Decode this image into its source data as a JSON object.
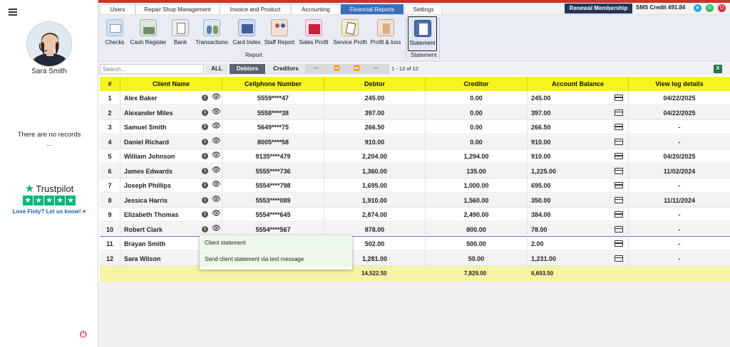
{
  "sidebar": {
    "user_name": "Sara Smith",
    "empty_text_line1": "There are no records",
    "empty_text_line2": "...",
    "trustpilot_label": "Trustpilot",
    "trustpilot_cta": "Love Finty? Let us know!"
  },
  "nav": {
    "tabs": [
      {
        "label": "Users"
      },
      {
        "label": "Repair Shop Management"
      },
      {
        "label": "Invoice and Product"
      },
      {
        "label": "Accounting"
      },
      {
        "label": "Financial Reports",
        "active": true
      },
      {
        "label": "Settings"
      }
    ],
    "renewal_button": "Renewal Membership",
    "sms_credit": "SMS Credit 491.84"
  },
  "ribbon": {
    "buttons": [
      {
        "label": "Checks",
        "icon": "checks-icon"
      },
      {
        "label": "Cash Register",
        "icon": "cash-register-icon"
      },
      {
        "label": "Bank",
        "icon": "bank-icon"
      },
      {
        "label": "Transactions",
        "icon": "transactions-icon"
      },
      {
        "label": "Card Index",
        "icon": "card-index-icon"
      },
      {
        "label": "Staff Report",
        "icon": "staff-report-icon"
      },
      {
        "label": "Sales Profit",
        "icon": "sales-profit-icon"
      },
      {
        "label": "Service Profit",
        "icon": "service-profit-icon"
      },
      {
        "label": "Profit & loss",
        "icon": "profit-loss-icon"
      },
      {
        "label": "Statement",
        "icon": "statement-icon",
        "selected": true
      }
    ],
    "group_report": "Report",
    "group_statement": "Statement"
  },
  "toolbar": {
    "search_placeholder": "Search...",
    "filter_all": "ALL",
    "filter_debtors": "Debtors",
    "filter_creditors": "Creditors",
    "page_info": "1 - 12 of 12",
    "export_icon": "excel-icon"
  },
  "table": {
    "headers": [
      "#",
      "Client Name",
      "Cellphone Number",
      "Debtor",
      "Creditor",
      "Account Balance",
      "View log details"
    ],
    "rows": [
      {
        "num": "1",
        "name": "Alex Baker",
        "phone": "5559****47",
        "debtor": "245.00",
        "creditor": "0.00",
        "balance": "245.00",
        "log": "04/22/2025"
      },
      {
        "num": "2",
        "name": "Alexander Miles",
        "phone": "5558****38",
        "debtor": "397.00",
        "creditor": "0.00",
        "balance": "397.00",
        "log": "04/22/2025"
      },
      {
        "num": "3",
        "name": "Samuel Smith",
        "phone": "5649****75",
        "debtor": "266.50",
        "creditor": "0.00",
        "balance": "266.50",
        "log": "-"
      },
      {
        "num": "4",
        "name": "Daniel Richard",
        "phone": "8005****58",
        "debtor": "910.00",
        "creditor": "0.00",
        "balance": "910.00",
        "log": "-"
      },
      {
        "num": "5",
        "name": "William Johnson",
        "phone": "9135****479",
        "debtor": "2,204.00",
        "creditor": "1,294.00",
        "balance": "910.00",
        "log": "04/20/2025"
      },
      {
        "num": "6",
        "name": "James Edwards",
        "phone": "5555****736",
        "debtor": "1,360.00",
        "creditor": "135.00",
        "balance": "1,225.00",
        "log": "11/02/2024"
      },
      {
        "num": "7",
        "name": "Joseph Phillips",
        "phone": "5554****798",
        "debtor": "1,695.00",
        "creditor": "1,000.00",
        "balance": "695.00",
        "log": "-"
      },
      {
        "num": "8",
        "name": "Jessica Harris",
        "phone": "5553****089",
        "debtor": "1,910.00",
        "creditor": "1,560.00",
        "balance": "350.00",
        "log": "11/11/2024"
      },
      {
        "num": "9",
        "name": "Elizabeth Thomas",
        "phone": "5554****645",
        "debtor": "2,874.00",
        "creditor": "2,490.00",
        "balance": "384.00",
        "log": "-"
      },
      {
        "num": "10",
        "name": "Robert Clark",
        "phone": "5554****567",
        "debtor": "878.00",
        "creditor": "800.00",
        "balance": "78.00",
        "log": "-"
      },
      {
        "num": "11",
        "name": "Brayan Smith",
        "phone": "",
        "debtor": "502.00",
        "creditor": "500.00",
        "balance": "2.00",
        "log": "-"
      },
      {
        "num": "12",
        "name": "Sara Wilson",
        "phone": "",
        "debtor": "1,281.00",
        "creditor": "50.00",
        "balance": "1,231.00",
        "log": "-"
      }
    ],
    "totals": {
      "debtor": "14,522.50",
      "creditor": "7,829.00",
      "balance": "6,693.50"
    }
  },
  "context_menu": {
    "items": [
      "Client statement",
      "Send client statement via text message"
    ]
  },
  "colors": {
    "header_yellow": "#f5f41f",
    "totals_yellow": "#f7f3a4",
    "active_tab": "#3b6ebd",
    "renewal_bg": "#22375a",
    "top_bar": "#c8352b"
  }
}
